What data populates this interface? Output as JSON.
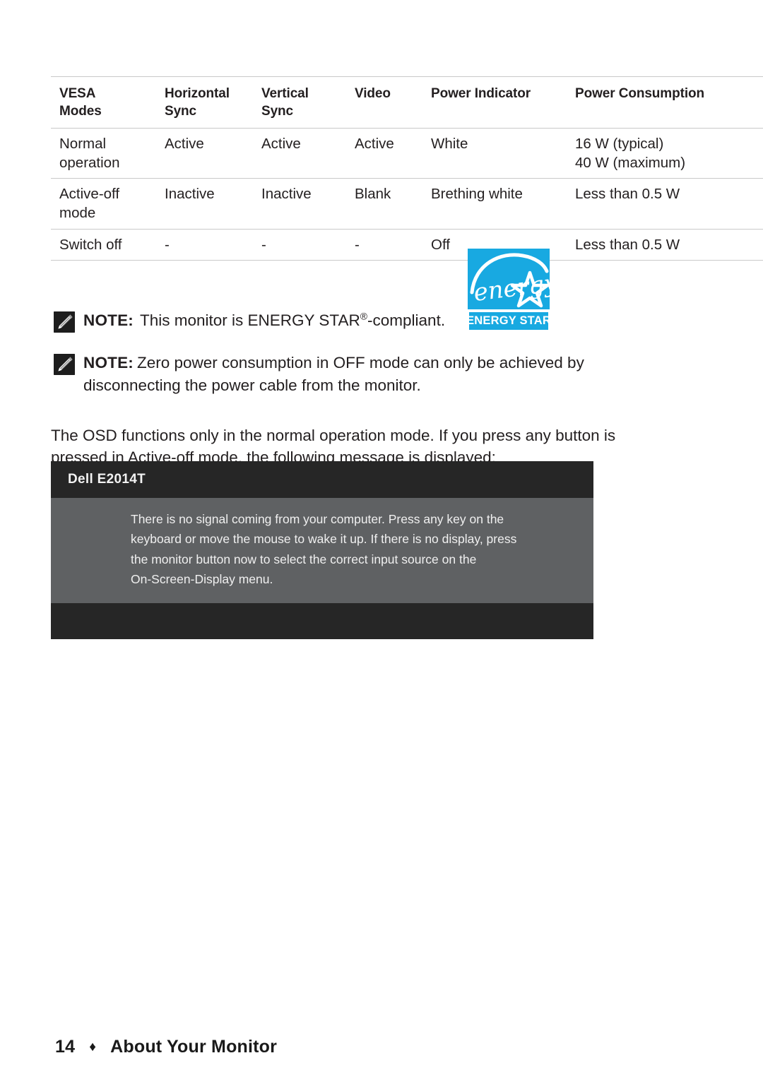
{
  "table": {
    "headers": [
      [
        "VESA",
        "Modes"
      ],
      [
        "Horizontal",
        "Sync"
      ],
      [
        "Vertical",
        "Sync"
      ],
      [
        "Video",
        ""
      ],
      [
        "Power Indicator",
        ""
      ],
      [
        "Power Consumption",
        ""
      ]
    ],
    "rows": [
      {
        "mode": [
          "Normal",
          "operation"
        ],
        "hsync": [
          "Active"
        ],
        "vsync": [
          "Active"
        ],
        "video": [
          "Active"
        ],
        "indicator": [
          "White"
        ],
        "consumption": [
          "16 W (typical)",
          "40 W (maximum)"
        ]
      },
      {
        "mode": [
          "Active-off",
          "mode"
        ],
        "hsync": [
          "Inactive"
        ],
        "vsync": [
          "Inactive"
        ],
        "video": [
          "Blank"
        ],
        "indicator": [
          "Brething white"
        ],
        "consumption": [
          "Less than 0.5 W"
        ]
      },
      {
        "mode": [
          "Switch off"
        ],
        "hsync": [
          "-"
        ],
        "vsync": [
          "-"
        ],
        "video": [
          "-"
        ],
        "indicator": [
          "Off"
        ],
        "consumption": [
          "Less than 0.5 W"
        ]
      }
    ]
  },
  "notes": [
    {
      "label": "NOTE:",
      "text_before_reg": "This monitor is ENERGY STAR",
      "reg": "®",
      "text_after_reg": "-compliant."
    },
    {
      "label": "NOTE:",
      "text": "Zero power consumption in OFF mode can only be achieved by disconnecting the power cable from the monitor."
    }
  ],
  "energy_star": {
    "wordmark": "ENERGY STAR",
    "script": "energy",
    "color": "#18a9e1"
  },
  "paragraph": "The OSD functions only in the normal operation mode. If you press any button is pressed in Active-off mode, the following message is displayed:",
  "osd": {
    "title": "Dell E2014T",
    "lines": [
      "There is no signal coming from your computer. Press any key on the",
      "keyboard or move the mouse to wake it up. If there is no display, press",
      "the monitor button now to select the correct input source on the",
      "On-Screen-Display menu."
    ],
    "header_color": "#262626",
    "body_color": "#5f6163"
  },
  "footer": {
    "page_number": "14",
    "separator": "♦",
    "title": "About Your Monitor"
  }
}
